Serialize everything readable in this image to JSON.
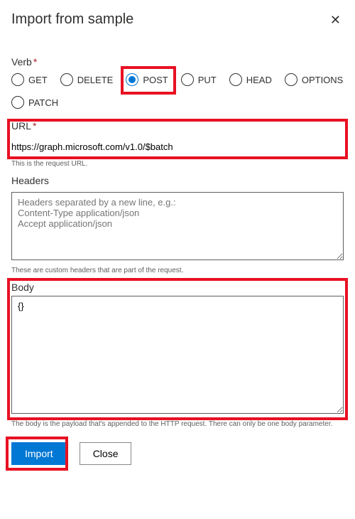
{
  "dialog": {
    "title": "Import from sample",
    "verb": {
      "label": "Verb",
      "options": [
        "GET",
        "DELETE",
        "POST",
        "PUT",
        "HEAD",
        "OPTIONS",
        "PATCH"
      ],
      "selected": "POST"
    },
    "url": {
      "label": "URL",
      "value": "https://graph.microsoft.com/v1.0/$batch",
      "helper": "This is the request URL."
    },
    "headers": {
      "label": "Headers",
      "placeholder": "Headers separated by a new line, e.g.:\nContent-Type application/json\nAccept application/json",
      "helper": "These are custom headers that are part of the request."
    },
    "body": {
      "label": "Body",
      "value": "{}",
      "helper": "The body is the payload that's appended to the HTTP request. There can only be one body parameter."
    },
    "buttons": {
      "import": "Import",
      "close": "Close"
    }
  }
}
